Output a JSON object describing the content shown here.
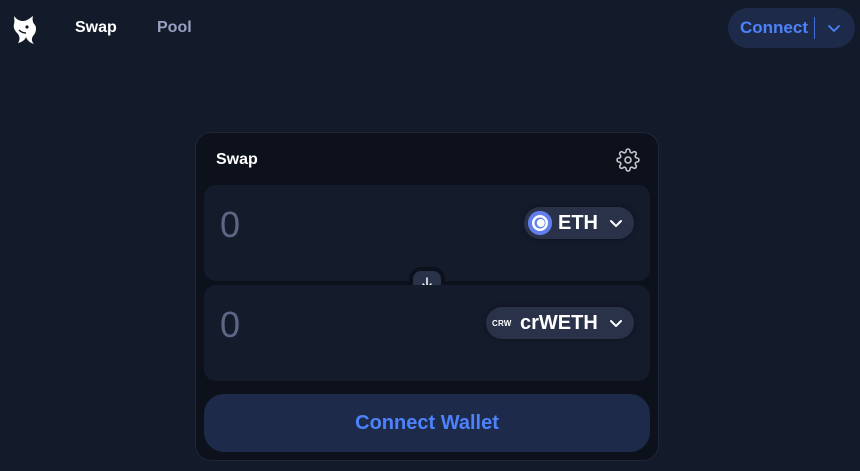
{
  "nav": {
    "logo_icon": "unicorn-logo-icon",
    "links": [
      {
        "label": "Swap",
        "active": true
      },
      {
        "label": "Pool",
        "active": false
      }
    ],
    "connect_label": "Connect",
    "connect_chevron_icon": "chevron-down-icon"
  },
  "swap": {
    "title": "Swap",
    "settings_icon": "gear-icon",
    "input": {
      "value": "0",
      "token_symbol": "ETH",
      "token_icon": "eth-token-icon"
    },
    "output": {
      "value": "0",
      "token_symbol": "crWETH",
      "token_icon_text": "CRW"
    },
    "switch_icon": "arrow-down-icon",
    "connect_wallet_label": "Connect Wallet"
  },
  "colors": {
    "background": "#131a2a",
    "card": "#0d111c",
    "panel": "#141b2b",
    "accent": "#4c82fb",
    "accent_bg": "#1e2a4a",
    "muted_text": "#98a1c0"
  }
}
